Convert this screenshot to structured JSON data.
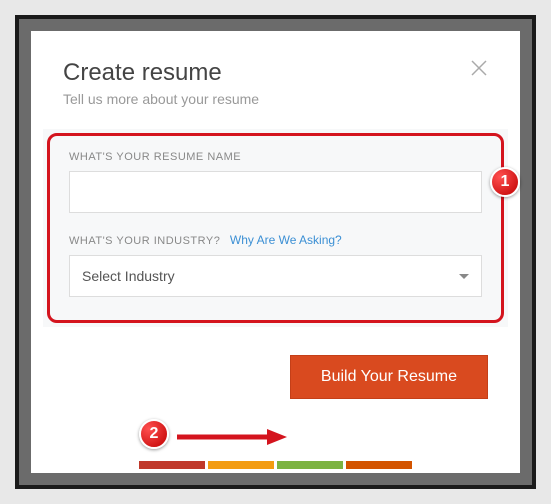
{
  "modal": {
    "title": "Create resume",
    "subtitle": "Tell us more about your resume"
  },
  "form": {
    "nameLabel": "WHAT'S YOUR RESUME NAME",
    "nameValue": "",
    "industryLabel": "WHAT'S YOUR INDUSTRY?",
    "helpLink": "Why Are We Asking?",
    "industryPlaceholder": "Select Industry"
  },
  "actions": {
    "buildBtn": "Build Your Resume"
  },
  "annotations": {
    "badge1": "1",
    "badge2": "2"
  }
}
